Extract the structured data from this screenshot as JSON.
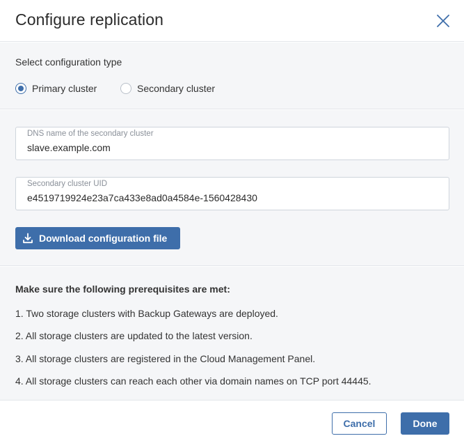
{
  "dialog": {
    "title": "Configure replication"
  },
  "config_type": {
    "label": "Select configuration type",
    "options": [
      {
        "label": "Primary cluster",
        "selected": true
      },
      {
        "label": "Secondary cluster",
        "selected": false
      }
    ]
  },
  "fields": {
    "dns": {
      "label": "DNS name of the secondary cluster",
      "value": "slave.example.com"
    },
    "uid": {
      "label": "Secondary cluster UID",
      "value": "e4519719924e23a7ca433e8ad0a4584e-1560428430"
    }
  },
  "download": {
    "label": "Download configuration file",
    "icon": "download-icon"
  },
  "prerequisites": {
    "title": "Make sure the following prerequisites are met:",
    "items": [
      "1. Two storage clusters with Backup Gateways are deployed.",
      "2. All storage clusters are updated to the latest version.",
      "3. All storage clusters are registered in the Cloud Management Panel.",
      "4. All storage clusters can reach each other via domain names on TCP port 44445."
    ]
  },
  "footer": {
    "cancel_label": "Cancel",
    "done_label": "Done"
  },
  "colors": {
    "accent": "#3e6eaa",
    "panel_background": "#f5f6f8",
    "border": "#e3e6ea"
  }
}
